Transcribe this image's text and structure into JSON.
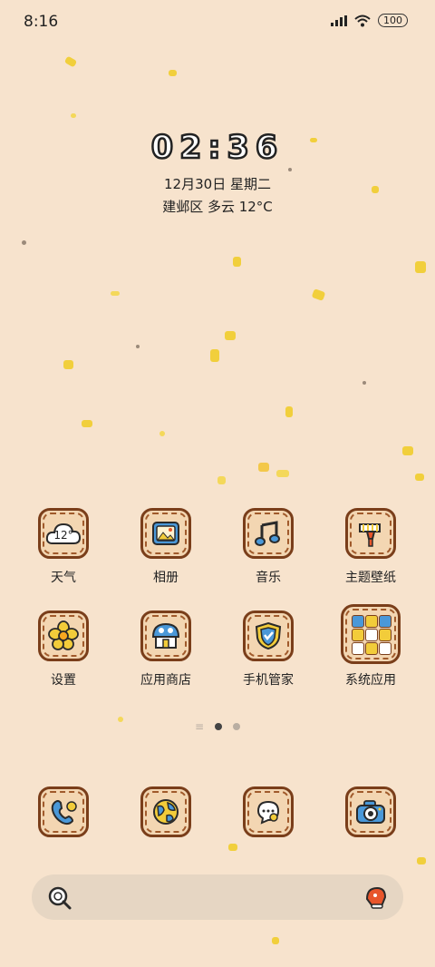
{
  "status_bar": {
    "time": "8:16",
    "battery": "100"
  },
  "lockscreen_widget": {
    "clock": "02:36",
    "date": "12月30日 星期二",
    "weather": "建邺区 多云 12°C"
  },
  "apps": [
    {
      "label": "天气",
      "icon": "weather-cloud-icon",
      "badge": "12°"
    },
    {
      "label": "相册",
      "icon": "gallery-icon"
    },
    {
      "label": "音乐",
      "icon": "music-note-icon"
    },
    {
      "label": "主题壁纸",
      "icon": "theme-brush-icon"
    },
    {
      "label": "设置",
      "icon": "settings-flower-icon"
    },
    {
      "label": "应用商店",
      "icon": "app-store-icon"
    },
    {
      "label": "手机管家",
      "icon": "security-shield-icon"
    },
    {
      "label": "系统应用",
      "icon": "folder-icon"
    }
  ],
  "dock": [
    {
      "icon": "phone-icon"
    },
    {
      "icon": "browser-globe-icon"
    },
    {
      "icon": "messages-icon"
    },
    {
      "icon": "camera-icon"
    }
  ],
  "page_indicator": {
    "pages": 2,
    "current": 1
  },
  "colors": {
    "background": "#f7e3cd",
    "icon_border": "#7a3e1a",
    "icon_fill": "#f3d6b2",
    "accent_yellow": "#f2cc3a",
    "accent_blue": "#4a98d8"
  }
}
